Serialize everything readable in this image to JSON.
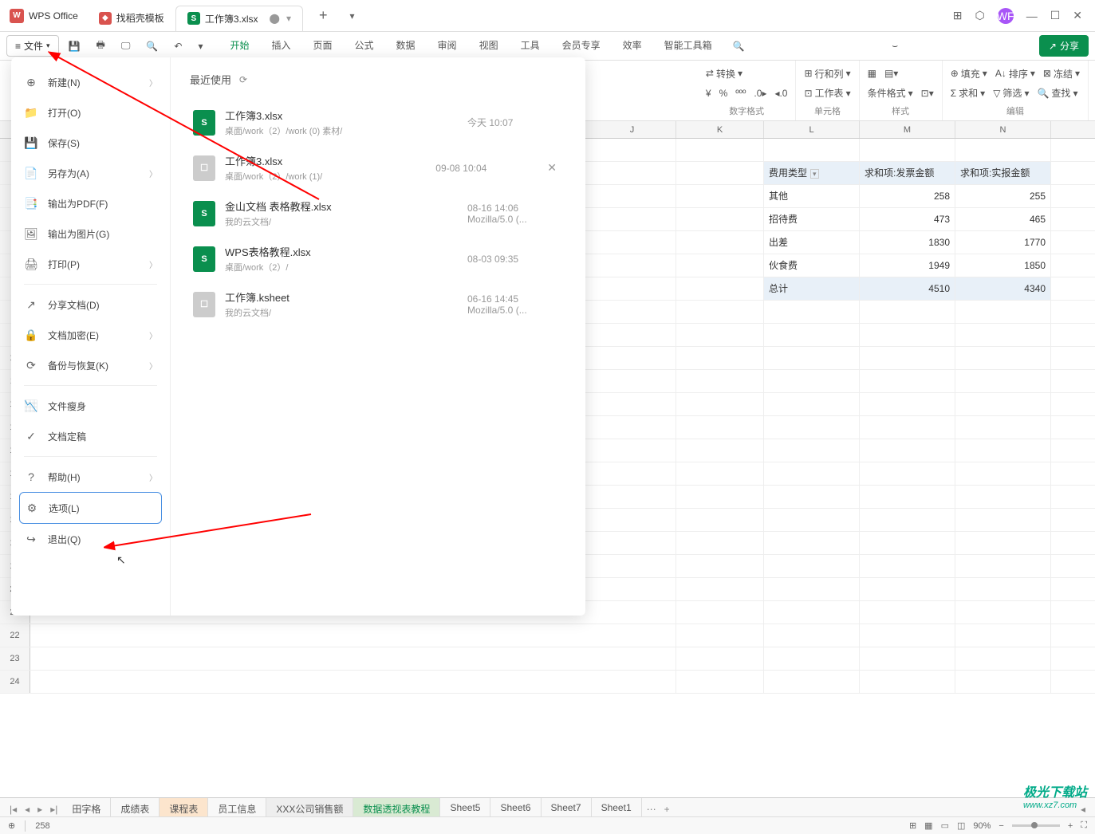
{
  "titlebar": {
    "app_name": "WPS Office",
    "template_tab": "找稻壳模板",
    "doc_tab": "工作簿3.xlsx"
  },
  "toolbar": {
    "file_btn": "文件",
    "share_btn": "分享"
  },
  "menu_tabs": [
    "开始",
    "插入",
    "页面",
    "公式",
    "数据",
    "审阅",
    "视图",
    "工具",
    "会员专享",
    "效率",
    "智能工具箱"
  ],
  "ribbon": {
    "convert": "转换",
    "num_fmt": "数字格式",
    "rowcol": "行和列",
    "worksheet": "工作表",
    "cells": "单元格",
    "cond_fmt": "条件格式",
    "styles": "样式",
    "fill": "填充",
    "sum": "求和",
    "sort": "排序",
    "filter": "筛选",
    "freeze": "冻结",
    "find": "查找",
    "edit": "编辑"
  },
  "file_menu": {
    "recent_title": "最近使用",
    "items": [
      {
        "icon": "⊕",
        "label": "新建(N)",
        "chev": true
      },
      {
        "icon": "📁",
        "label": "打开(O)"
      },
      {
        "icon": "💾",
        "label": "保存(S)"
      },
      {
        "icon": "📄",
        "label": "另存为(A)",
        "chev": true
      },
      {
        "icon": "📑",
        "label": "输出为PDF(F)"
      },
      {
        "icon": "🖼",
        "label": "输出为图片(G)"
      },
      {
        "icon": "🖨",
        "label": "打印(P)",
        "chev": true
      },
      {
        "icon": "↗",
        "label": "分享文档(D)"
      },
      {
        "icon": "🔒",
        "label": "文档加密(E)",
        "chev": true
      },
      {
        "icon": "⟳",
        "label": "备份与恢复(K)",
        "chev": true
      },
      {
        "icon": "📉",
        "label": "文件瘦身"
      },
      {
        "icon": "✓",
        "label": "文档定稿"
      },
      {
        "icon": "?",
        "label": "帮助(H)",
        "chev": true
      },
      {
        "icon": "⚙",
        "label": "选项(L)",
        "selected": true
      },
      {
        "icon": "↪",
        "label": "退出(Q)"
      }
    ],
    "recent": [
      {
        "name": "工作簿3.xlsx",
        "path": "桌面/work（2）/work (0) 素材/",
        "time": "今天 10:07",
        "green": true
      },
      {
        "name": "工作簿3.xlsx",
        "path": "桌面/work（2）/work (1)/",
        "time": "09-08 10:04",
        "green": false,
        "close": true
      },
      {
        "name": "金山文档 表格教程.xlsx",
        "path": "我的云文档/",
        "time": "08-16 14:06",
        "time2": "Mozilla/5.0 (...",
        "green": true
      },
      {
        "name": "WPS表格教程.xlsx",
        "path": "桌面/work（2）/",
        "time": "08-03 09:35",
        "green": true
      },
      {
        "name": "工作簿.ksheet",
        "path": "我的云文档/",
        "time": "06-16 14:45",
        "time2": "Mozilla/5.0 (...",
        "green": false
      }
    ]
  },
  "grid": {
    "cols": [
      "J",
      "K",
      "L",
      "M",
      "N"
    ],
    "headers": [
      "费用类型",
      "求和项:发票金额",
      "求和项:实报金额"
    ],
    "rows": [
      {
        "label": "其他",
        "v1": "258",
        "v2": "255"
      },
      {
        "label": "招待费",
        "v1": "473",
        "v2": "465"
      },
      {
        "label": "出差",
        "v1": "1830",
        "v2": "1770"
      },
      {
        "label": "伙食费",
        "v1": "1949",
        "v2": "1850"
      },
      {
        "label": "总计",
        "v1": "4510",
        "v2": "4340",
        "total": true
      }
    ]
  },
  "sheets": [
    "田字格",
    "成绩表",
    "课程表",
    "员工信息",
    "XXX公司销售额",
    "数据透视表教程",
    "Sheet5",
    "Sheet6",
    "Sheet7",
    "Sheet1"
  ],
  "status": {
    "cell_val": "258",
    "zoom": "90%"
  },
  "watermark": {
    "l1": "极光下载站",
    "l2": "www.xz7.com"
  }
}
